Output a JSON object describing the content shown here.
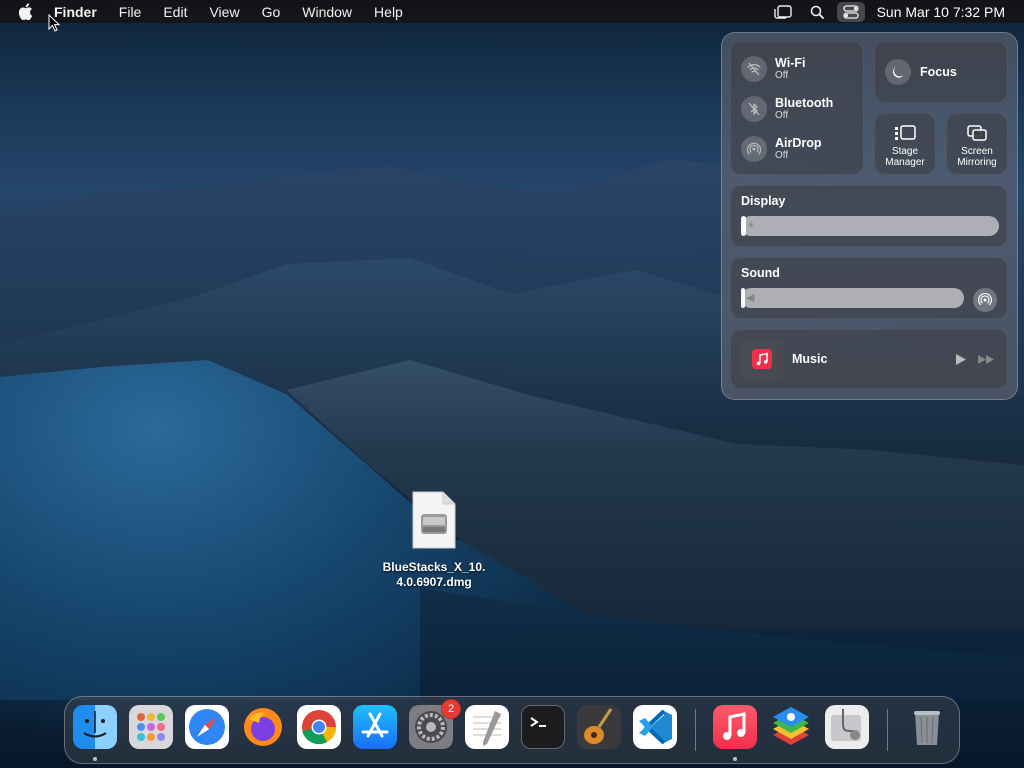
{
  "menubar": {
    "app_name": "Finder",
    "menus": [
      "File",
      "Edit",
      "View",
      "Go",
      "Window",
      "Help"
    ],
    "clock": "Sun Mar 10  7:32 PM",
    "status_icons": [
      "stage-manager-icon",
      "search-icon",
      "control-center-icon"
    ]
  },
  "control_center": {
    "wifi": {
      "title": "Wi-Fi",
      "status": "Off"
    },
    "bluetooth": {
      "title": "Bluetooth",
      "status": "Off"
    },
    "airdrop": {
      "title": "AirDrop",
      "status": "Off"
    },
    "focus": {
      "label": "Focus"
    },
    "stage_manager": {
      "line1": "Stage",
      "line2": "Manager"
    },
    "screen_mirroring": {
      "line1": "Screen",
      "line2": "Mirroring"
    },
    "display": {
      "title": "Display",
      "level": 0.02
    },
    "sound": {
      "title": "Sound",
      "level": 0.02
    },
    "music": {
      "title": "Music"
    }
  },
  "desktop": {
    "file": {
      "line1": "BlueStacks_X_10.",
      "line2": "4.0.6907.dmg"
    }
  },
  "dock": {
    "apps": [
      {
        "name": "Finder",
        "running": true
      },
      {
        "name": "Launchpad",
        "running": false
      },
      {
        "name": "Safari",
        "running": false
      },
      {
        "name": "Firefox",
        "running": false
      },
      {
        "name": "Chrome",
        "running": false
      },
      {
        "name": "App Store",
        "running": false
      },
      {
        "name": "System Settings",
        "running": false,
        "badge": "2"
      },
      {
        "name": "TextEdit",
        "running": false
      },
      {
        "name": "Terminal",
        "running": false
      },
      {
        "name": "GarageBand",
        "running": false
      },
      {
        "name": "Visual Studio Code",
        "running": false
      },
      {
        "name": "Music",
        "running": true
      },
      {
        "name": "BlueStacks",
        "running": false
      },
      {
        "name": "Disk Utility",
        "running": false
      },
      {
        "name": "Trash",
        "running": false
      }
    ]
  }
}
